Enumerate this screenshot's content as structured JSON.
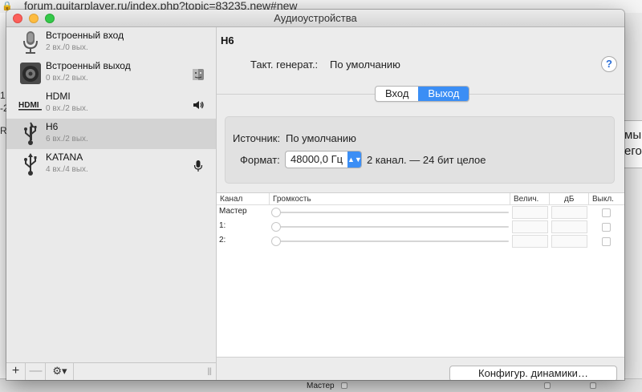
{
  "browser": {
    "url": "forum.guitarplayer.ru/index.php?topic=83235.new#new",
    "right_text_1": "мы",
    "right_text_2": "его",
    "left_chars": [
      "1",
      "-2",
      "R"
    ],
    "bottom_label": "Мастер"
  },
  "window": {
    "title": "Аудиоустройства"
  },
  "sidebar": {
    "devices": [
      {
        "name": "Встроенный вход",
        "channels": "2 вх./0 вых.",
        "icon": "microphone-icon"
      },
      {
        "name": "Встроенный выход",
        "channels": "0 вх./2 вых.",
        "icon": "speaker-icon",
        "badge": "finder-icon"
      },
      {
        "name": "HDMI",
        "channels": "0 вх./2 вых.",
        "icon": "hdmi-icon",
        "badge": "volume-icon"
      },
      {
        "name": "H6",
        "channels": "6 вх./2 вых.",
        "icon": "usb-icon",
        "selected": true
      },
      {
        "name": "KATANA",
        "channels": "4 вх./4 вых.",
        "icon": "usb-icon",
        "badge": "microphone-small-icon"
      }
    ],
    "add_label": "+",
    "remove_label": "—",
    "gear_label": "⚙▾"
  },
  "detail": {
    "device_title": "H6",
    "clock_label": "Такт. генерат.:",
    "clock_value": "По умолчанию",
    "help_label": "?",
    "tabs": [
      {
        "label": "Вход",
        "active": false
      },
      {
        "label": "Выход",
        "active": true
      }
    ],
    "source_label": "Источник:",
    "source_value": "По умолчанию",
    "format_label": "Формат:",
    "format_value": "48000,0 Гц",
    "format_desc": "2 канал. — 24 бит целое",
    "table": {
      "headers": [
        "Канал",
        "Громкость",
        "Велич.",
        "дБ",
        "Выкл."
      ],
      "rows": [
        {
          "channel": "Мастер"
        },
        {
          "channel": "1:"
        },
        {
          "channel": "2:"
        }
      ]
    },
    "configure_button": "Конфигур. динамики…"
  },
  "colors": {
    "accent": "#3b8ef5",
    "selection": "#d3d3d3"
  }
}
